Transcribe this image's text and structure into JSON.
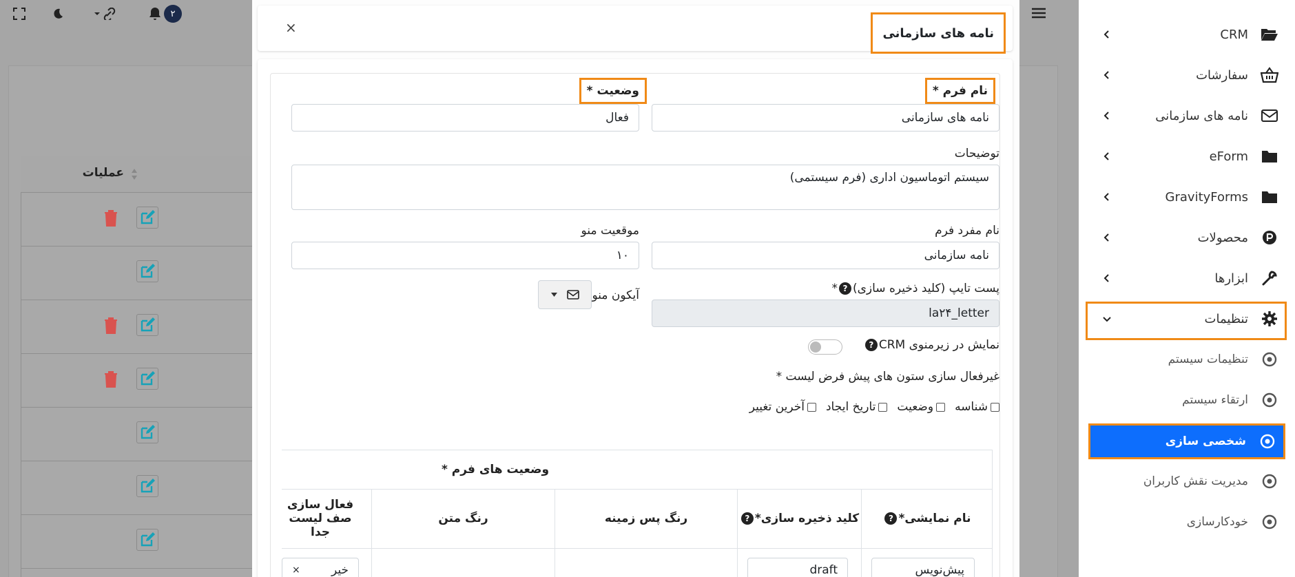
{
  "topbar": {
    "fullscreen_icon": "expand-icon",
    "dark_mode_icon": "moon-icon",
    "link_icon": "link-icon",
    "notification_icon": "bell-icon",
    "notification_count": "۲",
    "menu_icon": "hamburger-icon"
  },
  "background_table": {
    "operations_header": "عملیات"
  },
  "sidebar": {
    "items": [
      {
        "label": "CRM",
        "icon": "folder-open-icon"
      },
      {
        "label": "سفارشات",
        "icon": "basket-icon"
      },
      {
        "label": "نامه های سازمانی",
        "icon": "envelope-icon"
      },
      {
        "label": "eForm",
        "icon": "folder-icon"
      },
      {
        "label": "GravityForms",
        "icon": "folder-icon"
      },
      {
        "label": "محصولات",
        "icon": "product-p-icon"
      },
      {
        "label": "ابزارها",
        "icon": "wrench-icon"
      },
      {
        "label": "تنظیمات",
        "icon": "gear-icon"
      }
    ],
    "subitems": [
      {
        "label": "تنظیمات سیستم"
      },
      {
        "label": "ارتقاء سیستم"
      },
      {
        "label": "شخصی سازی"
      },
      {
        "label": "مدیریت نقش کاربران"
      },
      {
        "label": "خودکارسازی"
      }
    ],
    "active_color": "#0d6efd"
  },
  "modal": {
    "title": "نامه های سازمانی",
    "close": "×",
    "form": {
      "form_name_label": "نام فرم *",
      "form_name_value": "نامه های سازمانی",
      "status_label": "وضعیت *",
      "status_value": "فعال",
      "description_label": "توضیحات",
      "description_value": "سیستم اتوماسیون اداری (فرم سیستمی)",
      "singular_label": "نام مفرد فرم",
      "singular_value": "نامه سازمانی",
      "menu_position_label": "موقعیت منو",
      "menu_position_value": "۱۰",
      "post_type_label": "پست تایپ (کلید ذخیره سازی)",
      "post_type_star": "*",
      "post_type_value": "la۲۴_letter",
      "menu_icon_label": "آیکون منو",
      "show_in_crm_label": "نمایش در زیرمنوی CRM",
      "disable_columns_label": "غیرفعال سازی ستون های پیش فرض لیست *",
      "checkboxes": [
        "شناسه",
        "وضعیت",
        "تاریخ ایجاد",
        "آخرین تغییر"
      ]
    },
    "statuses": {
      "title": "وضعیت های فرم *",
      "headers": [
        "نام نمایشی*",
        "کلید ذخیره سازی*",
        "رنگ پس زمینه",
        "رنگ متن",
        "فعال سازی صف لیست جدا"
      ],
      "row": {
        "display_name": "پیش‌نویس",
        "key": "draft",
        "toggle_value": "خیر"
      }
    }
  },
  "colors": {
    "highlight": "#f08a17",
    "edit": "#17a2b8",
    "delete": "#dc3545"
  }
}
